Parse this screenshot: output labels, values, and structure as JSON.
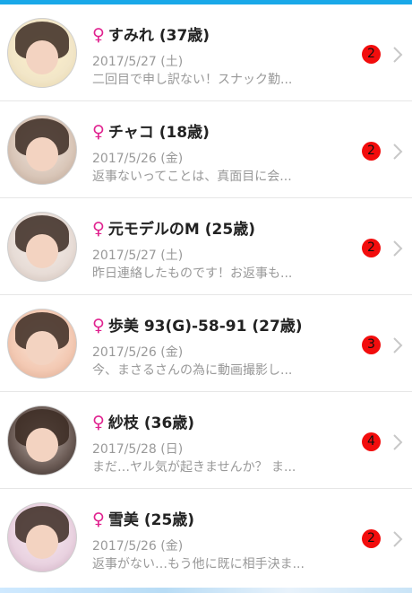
{
  "messages": [
    {
      "name": "すみれ",
      "age": "(37歳)",
      "date": "2017/5/27 (土)",
      "preview": "二回目で申し訳ない！スナック勤...",
      "unread": "2",
      "gender_symbol": "♀",
      "avatar_colors": [
        "#f2e6c8",
        "#fff2cc"
      ]
    },
    {
      "name": "チャコ",
      "age": "(18歳)",
      "date": "2017/5/26 (金)",
      "preview": "返事ないってことは、真面目に会...",
      "unread": "2",
      "gender_symbol": "♀",
      "avatar_colors": [
        "#d9c6b8",
        "#efe6df"
      ]
    },
    {
      "name": "元モデルのM",
      "age": "(25歳)",
      "date": "2017/5/27 (土)",
      "preview": "昨日連絡したものです！お返事も...",
      "unread": "2",
      "gender_symbol": "♀",
      "avatar_colors": [
        "#e7dcd6",
        "#f5eeea"
      ]
    },
    {
      "name": "歩美 93(G)-58-91",
      "age": "(27歳)",
      "date": "2017/5/26 (金)",
      "preview": "今、まさるさんの為に動画撮影し...",
      "unread": "3",
      "gender_symbol": "♀",
      "avatar_colors": [
        "#f3c9b3",
        "#fbe6d8"
      ]
    },
    {
      "name": "紗枝",
      "age": "(36歳)",
      "date": "2017/5/28 (日)",
      "preview": "まだ…ヤル気が起きませんか？ ま...",
      "unread": "4",
      "gender_symbol": "♀",
      "avatar_colors": [
        "#6b5b55",
        "#bfb3ae"
      ]
    },
    {
      "name": "雪美",
      "age": "(25歳)",
      "date": "2017/5/26 (金)",
      "preview": "返事がない…もう他に既に相手決ま...",
      "unread": "2",
      "gender_symbol": "♀",
      "avatar_colors": [
        "#e9d2e0",
        "#f7eaf2"
      ]
    }
  ],
  "theme": {
    "accent": "#19a8e8",
    "badge": "#f20d0d",
    "gender": "#e0228f"
  }
}
